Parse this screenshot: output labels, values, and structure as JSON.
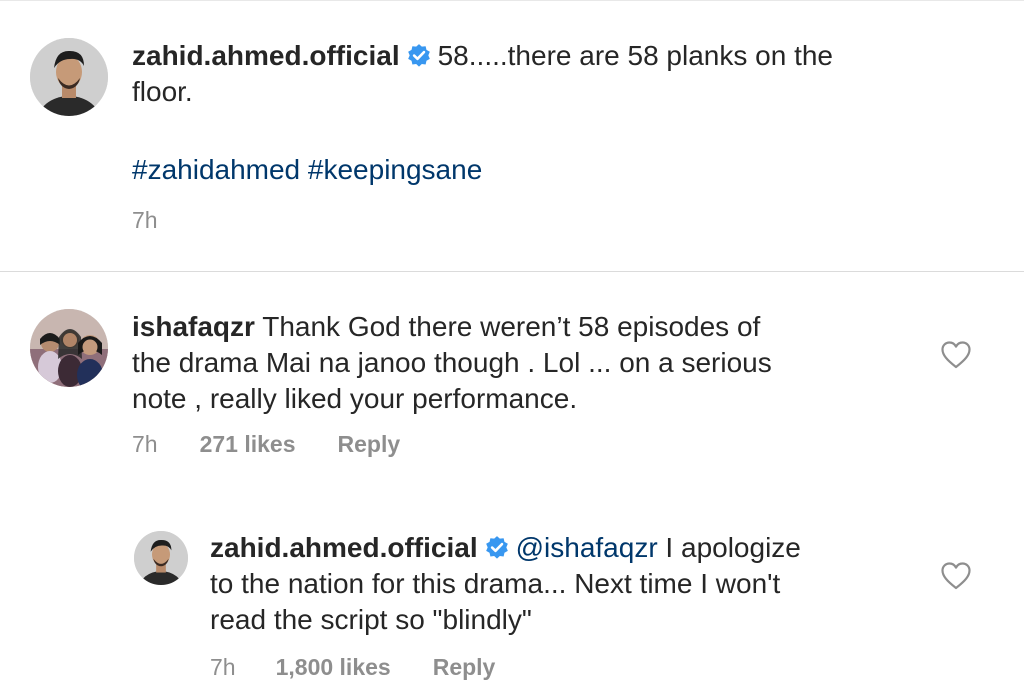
{
  "post": {
    "username": "zahid.ahmed.official",
    "text_line1": "58.....there are 58 planks on the",
    "text_line2": "floor.",
    "hashtags": "#zahidahmed #keepingsane",
    "time": "7h"
  },
  "comments": [
    {
      "username": "ishafaqzr",
      "line1": "Thank God there weren’t 58 episodes of",
      "line2": "the drama Mai na janoo though . Lol ... on a serious",
      "line3": "note , really liked your performance.",
      "time": "7h",
      "likes": "271 likes",
      "reply": "Reply"
    }
  ],
  "reply": {
    "username": "zahid.ahmed.official",
    "mention": "@ishafaqzr",
    "line1_rest": " I apologize",
    "line2": "to the nation for this drama... Next time I won't",
    "line3": "read the script so \"blindly\"",
    "time": "7h",
    "likes": "1,800 likes",
    "reply": "Reply"
  },
  "colors": {
    "text": "#262626",
    "secondary": "#8e8e8e",
    "link": "#00376b",
    "verified": "#3897f0",
    "divider": "#dbdbdb"
  },
  "icons": {
    "verified": "verified-badge-icon",
    "like": "heart-outline-icon"
  }
}
